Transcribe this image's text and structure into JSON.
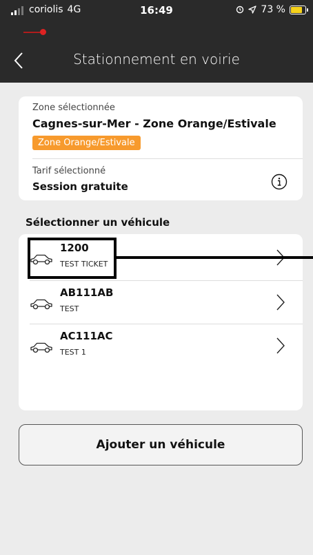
{
  "status_bar": {
    "carrier": "coriolis",
    "network": "4G",
    "time": "16:49",
    "battery": "73 %"
  },
  "nav": {
    "title": "Stationnement en voirie"
  },
  "zone": {
    "label": "Zone sélectionnée",
    "name": "Cagnes-sur-Mer - Zone Orange/Estivale",
    "tag": "Zone Orange/Estivale",
    "tag_color": "#f79a2d"
  },
  "tarif": {
    "label": "Tarif sélectionné",
    "name": "Session gratuite"
  },
  "vehicles_section": {
    "title": "Sélectionner un véhicule"
  },
  "vehicles": [
    {
      "plate": "1200",
      "name": "TEST TICKET"
    },
    {
      "plate": "AB111AB",
      "name": "TEST"
    },
    {
      "plate": "AC111AC",
      "name": "TEST 1"
    }
  ],
  "add_vehicle": {
    "label": "Ajouter un véhicule"
  }
}
